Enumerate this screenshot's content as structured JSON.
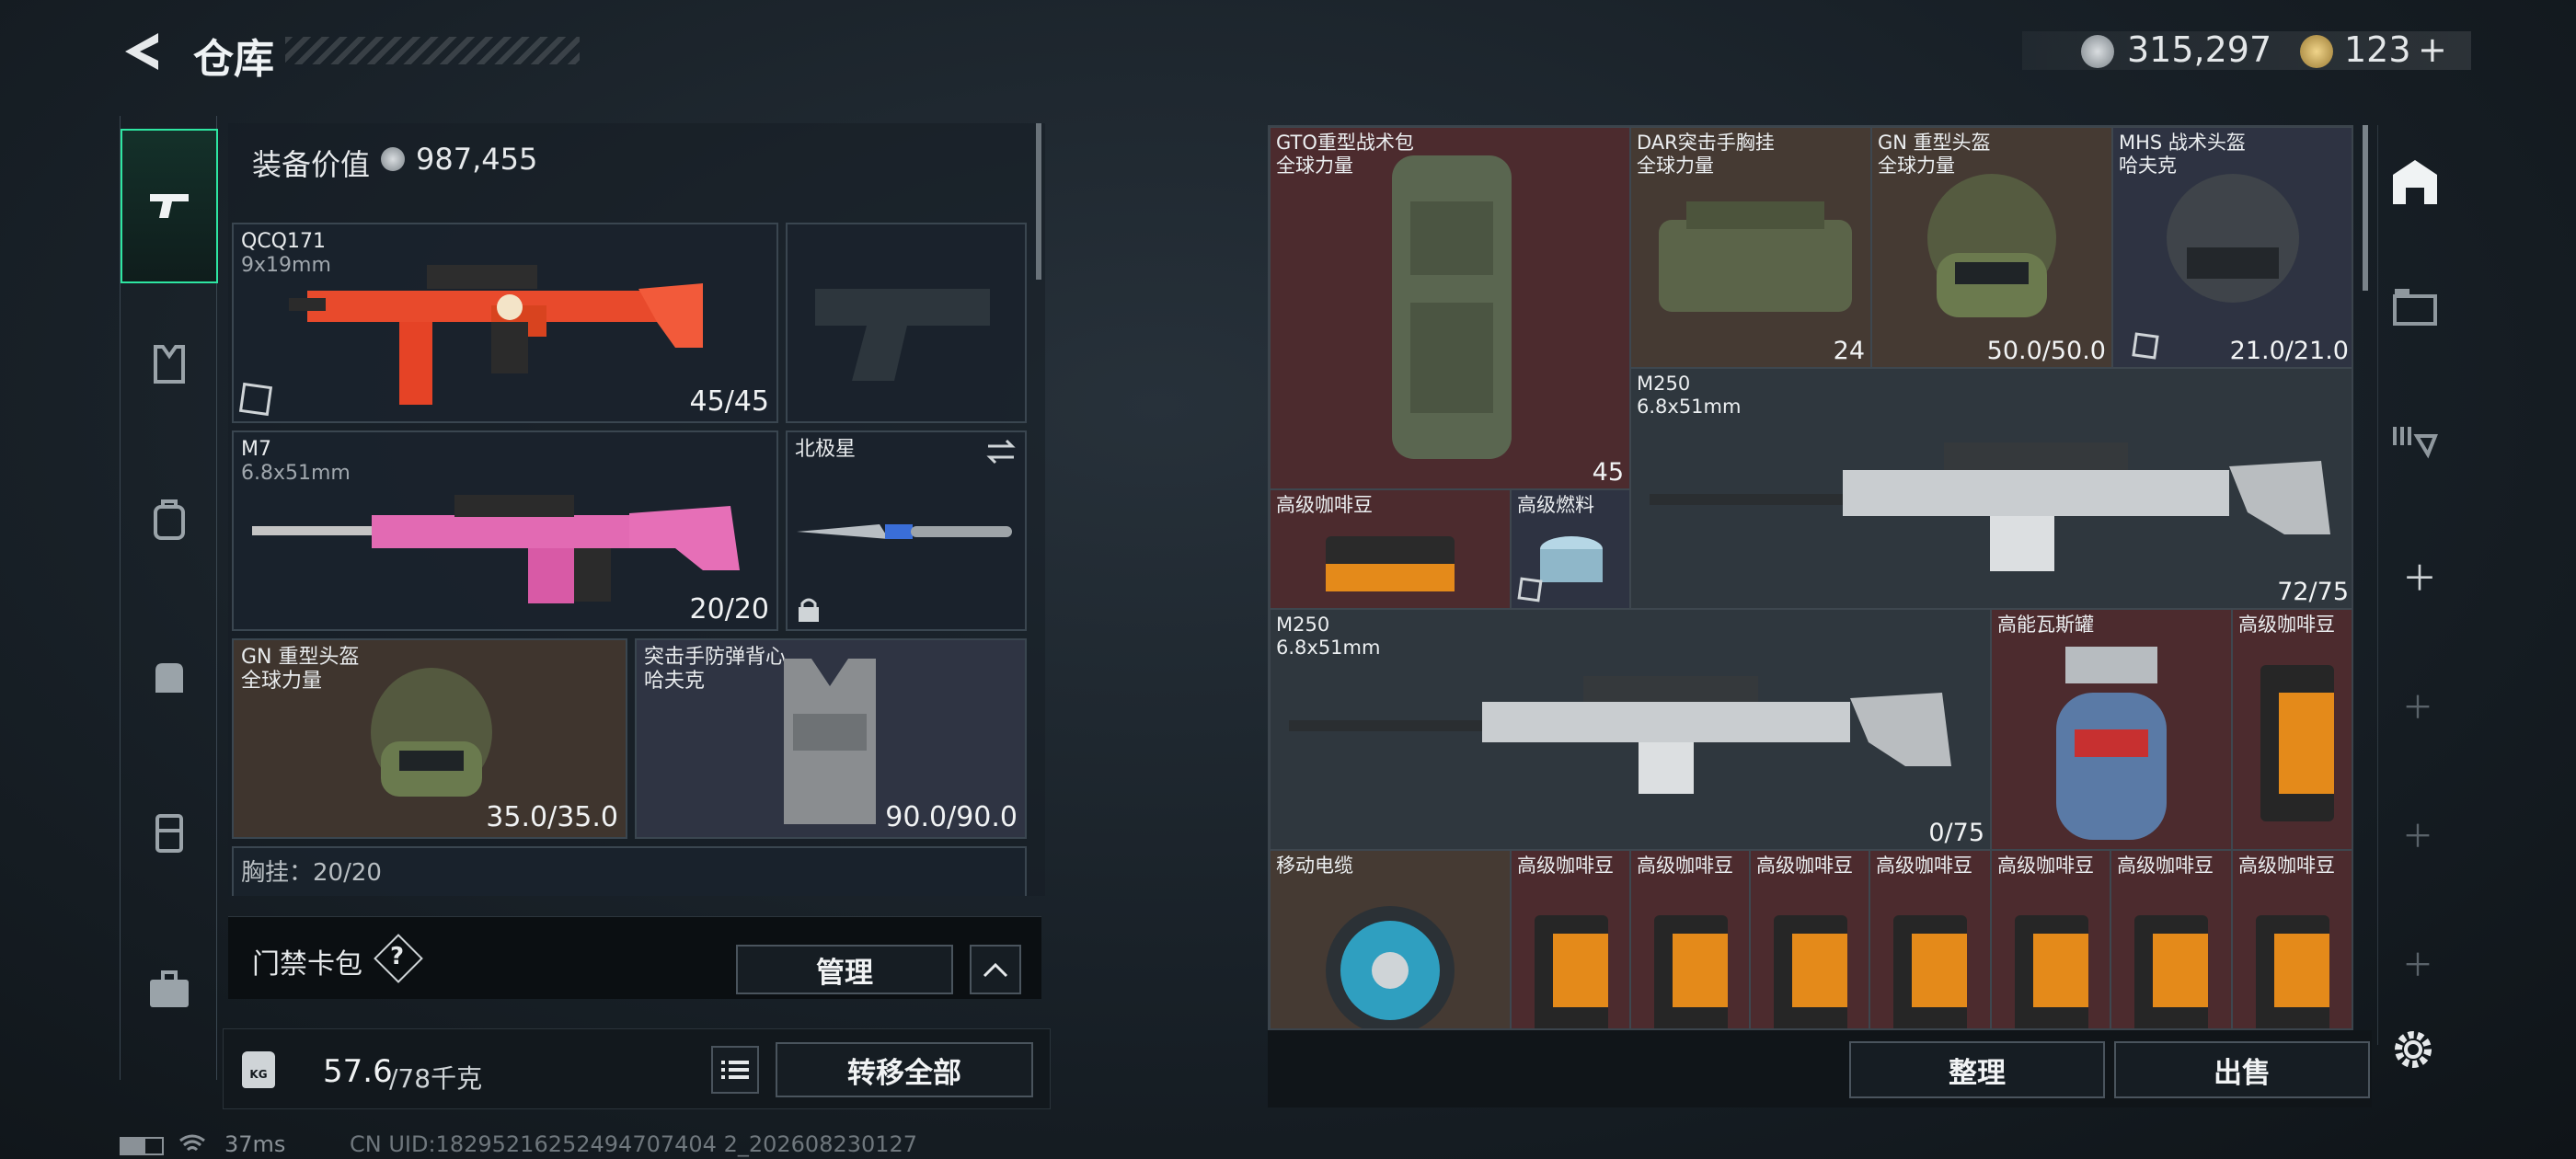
{
  "header": {
    "title": "仓库",
    "silver": "315,297",
    "gold": "123",
    "gold_plus": "+"
  },
  "loadout": {
    "value_label": "装备价值",
    "value": "987,455",
    "primary": {
      "name": "QCQ171",
      "caliber": "9x19mm",
      "ammo": "45/45"
    },
    "secondary": {
      "name": "M7",
      "caliber": "6.8x51mm",
      "ammo": "20/20"
    },
    "melee": {
      "name": "北极星"
    },
    "helmet": {
      "name": "GN 重型头盔",
      "rarity": "全球力量",
      "durability": "35.0/35.0"
    },
    "armor": {
      "name": "突击手防弹背心",
      "rarity": "哈夫克",
      "durability": "90.0/90.0"
    },
    "chest_rig_peek": "胸挂：20/20",
    "card_pack": {
      "label": "门禁卡包",
      "help": "?",
      "manage_label": "管理"
    },
    "weight": {
      "value": "57.6",
      "max": "/78千克",
      "icon_label": "KG"
    },
    "transfer_all_label": "转移全部"
  },
  "stash": {
    "items": [
      {
        "name": "GTO重型战术包",
        "sub": "全球力量",
        "value": "45"
      },
      {
        "name": "DAR突击手胸挂",
        "sub": "全球力量",
        "value": "24"
      },
      {
        "name": "GN 重型头盔",
        "sub": "全球力量",
        "value": "50.0/50.0"
      },
      {
        "name": "MHS 战术头盔",
        "sub": "哈夫克",
        "value": "21.0/21.0"
      },
      {
        "name": "M250",
        "sub": "6.8x51mm",
        "value": "72/75"
      },
      {
        "name": "高级咖啡豆",
        "sub": "",
        "value": ""
      },
      {
        "name": "高级燃料",
        "sub": "",
        "value": ""
      },
      {
        "name": "M250",
        "sub": "6.8x51mm",
        "value": "0/75"
      },
      {
        "name": "高能瓦斯罐",
        "sub": "",
        "value": ""
      },
      {
        "name": "高级咖啡豆",
        "sub": "",
        "value": ""
      },
      {
        "name": "移动电缆",
        "sub": "",
        "value": ""
      },
      {
        "name": "高级咖啡豆",
        "sub": "",
        "value": ""
      },
      {
        "name": "高级咖啡豆",
        "sub": "",
        "value": ""
      },
      {
        "name": "高级咖啡豆",
        "sub": "",
        "value": ""
      },
      {
        "name": "高级咖啡豆",
        "sub": "",
        "value": ""
      },
      {
        "name": "高级咖啡豆",
        "sub": "",
        "value": ""
      },
      {
        "name": "高级咖啡豆",
        "sub": "",
        "value": ""
      },
      {
        "name": "高级咖啡豆",
        "sub": "",
        "value": ""
      }
    ],
    "sort_label": "整理",
    "sell_label": "出售"
  },
  "status": {
    "ping": "37ms",
    "uid": "CN UID:18295216252494707404 2_202608230127"
  },
  "colors": {
    "accent": "#2ee6a2",
    "red_cell": "#4c2b2e",
    "brown_cell": "#453a33",
    "navy_cell": "#2e3342"
  }
}
